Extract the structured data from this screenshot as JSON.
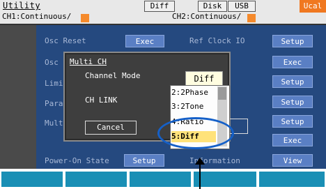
{
  "header": {
    "title": "Utility",
    "tab_diff": "Diff",
    "tab_disk": "Disk",
    "tab_usb": "USB",
    "ucal": "Ucal",
    "ch1": "CH1:Continuous/",
    "ch2": "CH2:Continuous/"
  },
  "menu": {
    "osc_reset": "Osc Reset",
    "osc_reset_btn": "Exec",
    "osc_short": "Osc",
    "limit_short": "Limi",
    "param_short": "Para",
    "multi_short": "Mult",
    "ref_clock": "Ref Clock IO",
    "ref_clock_btn": "Setup",
    "exec_btn_2": "Exec",
    "setup_btn_3": "Setup",
    "setup_btn_4": "Setup",
    "setup_btn_5": "Setup",
    "exec_btn_6": "Exec",
    "power_on_state": "Power-On State",
    "power_on_btn": "Setup",
    "information": "Information",
    "view_btn": "View"
  },
  "dialog": {
    "title": "Multi CH",
    "channel_mode_label": "Channel Mode",
    "channel_mode_value": "Diff",
    "ch_link_label": "CH LINK",
    "cancel_label": "Cancel"
  },
  "dropdown": {
    "options": [
      "2:2Phase",
      "3:2Tone",
      "4:Ratio",
      "5:Diff"
    ],
    "selected": "5:Diff"
  },
  "colors": {
    "accent": "#f07820",
    "menu_bg": "#25497f",
    "button": "#5a7fc4",
    "softkey": "#1a8fb5",
    "highlight": "#1560c8",
    "selection": "#ffe27a"
  }
}
